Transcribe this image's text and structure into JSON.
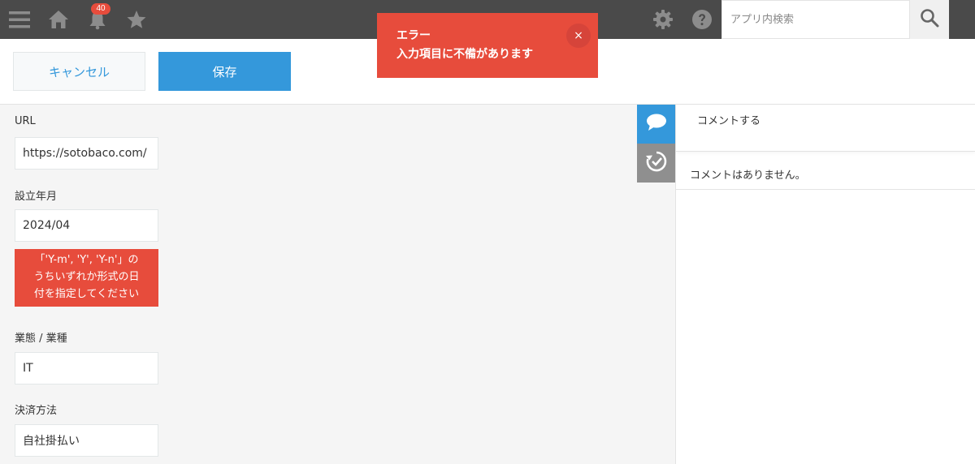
{
  "header": {
    "notification_count": "40",
    "search_placeholder": "アプリ内検索",
    "icons": [
      "menu-icon",
      "home-icon",
      "bell-icon",
      "star-icon",
      "gear-icon",
      "help-icon",
      "search-icon"
    ]
  },
  "toolbar": {
    "cancel_label": "キャンセル",
    "save_label": "保存"
  },
  "toast": {
    "title": "エラー",
    "message": "入力項目に不備があります",
    "close_label": "×"
  },
  "form": {
    "fields": [
      {
        "label": "URL",
        "value": "https://sotobaco.com/"
      },
      {
        "label": "設立年月",
        "value": "2024/04",
        "error": [
          "「'Y-m', 'Y', 'Y-n'」の",
          "うちいずれか形式の日",
          "付を指定してください"
        ]
      },
      {
        "label": "業態 / 業種",
        "value": "IT"
      },
      {
        "label": "決済方法",
        "value": "自社掛払い"
      }
    ]
  },
  "sidebar": {
    "tabs": [
      "comment-icon",
      "history-icon"
    ],
    "comment_placeholder": "コメントする",
    "no_comments": "コメントはありません。"
  },
  "colors": {
    "header_bg": "#4a4a4a",
    "accent": "#3498db",
    "error": "#e74c3c"
  }
}
